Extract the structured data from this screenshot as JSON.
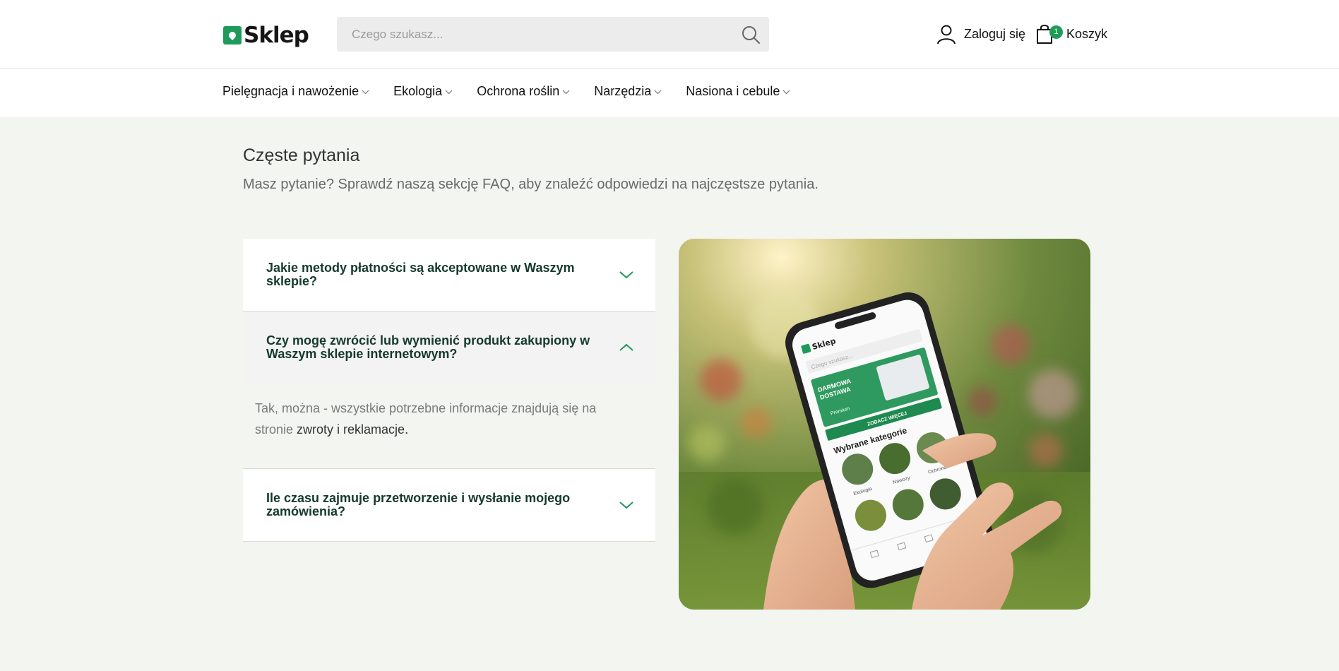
{
  "header": {
    "logo_text": "Sklep",
    "search_placeholder": "Czego szukasz...",
    "login_label": "Zaloguj się",
    "cart_count": "1",
    "cart_label": "Koszyk"
  },
  "nav": {
    "items": [
      {
        "label": "Pielęgnacja i nawożenie"
      },
      {
        "label": "Ekologia"
      },
      {
        "label": "Ochrona roślin"
      },
      {
        "label": "Narzędzia"
      },
      {
        "label": "Nasiona i cebule"
      }
    ]
  },
  "faq": {
    "title": "Częste pytania",
    "subtitle": "Masz pytanie? Sprawdź naszą sekcję FAQ, aby znaleźć odpowiedzi na najczęstsze pytania.",
    "items": [
      {
        "question": "Jakie metody płatności są akceptowane w Waszym sklepie?",
        "expanded": false
      },
      {
        "question": "Czy mogę zwrócić lub wymienić produkt zakupiony w Waszym sklepie internetowym?",
        "expanded": true,
        "answer_text": "Tak, można - wszystkie potrzebne informacje znajdują się na stronie ",
        "answer_link": "zwroty i reklamacje."
      },
      {
        "question": "Ile czasu zajmuje przetworzenie i wysłanie mojego zamówienia?",
        "expanded": false
      }
    ]
  },
  "phone_screen": {
    "logo_text": "Sklep",
    "search_placeholder": "Czego szukasz...",
    "banner_line1": "DARMOWA",
    "banner_line2": "DOSTAWA",
    "banner_premium": "Premium",
    "banner_button": "ZOBACZ WIĘCEJ",
    "categories_title": "Wybrane kategorie",
    "categories": [
      "Ekologia",
      "Nawozy",
      "Ochrona"
    ]
  },
  "colors": {
    "brand_green": "#1f9a5a",
    "faq_text": "#153a2c",
    "section_bg": "#f2f5f0"
  }
}
